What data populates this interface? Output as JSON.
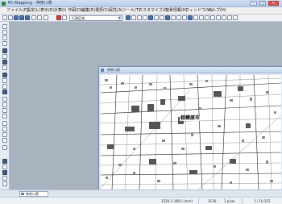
{
  "window": {
    "title": "PC-Mapping - 神奈川県",
    "minimize": "–",
    "maximize": "□",
    "close": "✕"
  },
  "menu": [
    "ファイル(F)",
    "設定(L)",
    "表示(E)",
    "計算(I)",
    "作図(D)",
    "編集(E)",
    "選択(S)",
    "属性(A)",
    "ツール(T)",
    "カスタマイズ(C)",
    "背景情報(K)",
    "ウィンドウ(W)",
    "ヘルプ(H)"
  ],
  "toolbar": {
    "layer_select": "行政区域"
  },
  "map_window": {
    "title": "神奈川県",
    "place_label": "相模原市"
  },
  "tabs": [
    {
      "label": "神奈川県"
    }
  ],
  "status": {
    "coords": "1220.3   398.5 (mm)",
    "scale": "1136 :",
    "unit": "1 pixel",
    "page": "1 / 10,152"
  }
}
